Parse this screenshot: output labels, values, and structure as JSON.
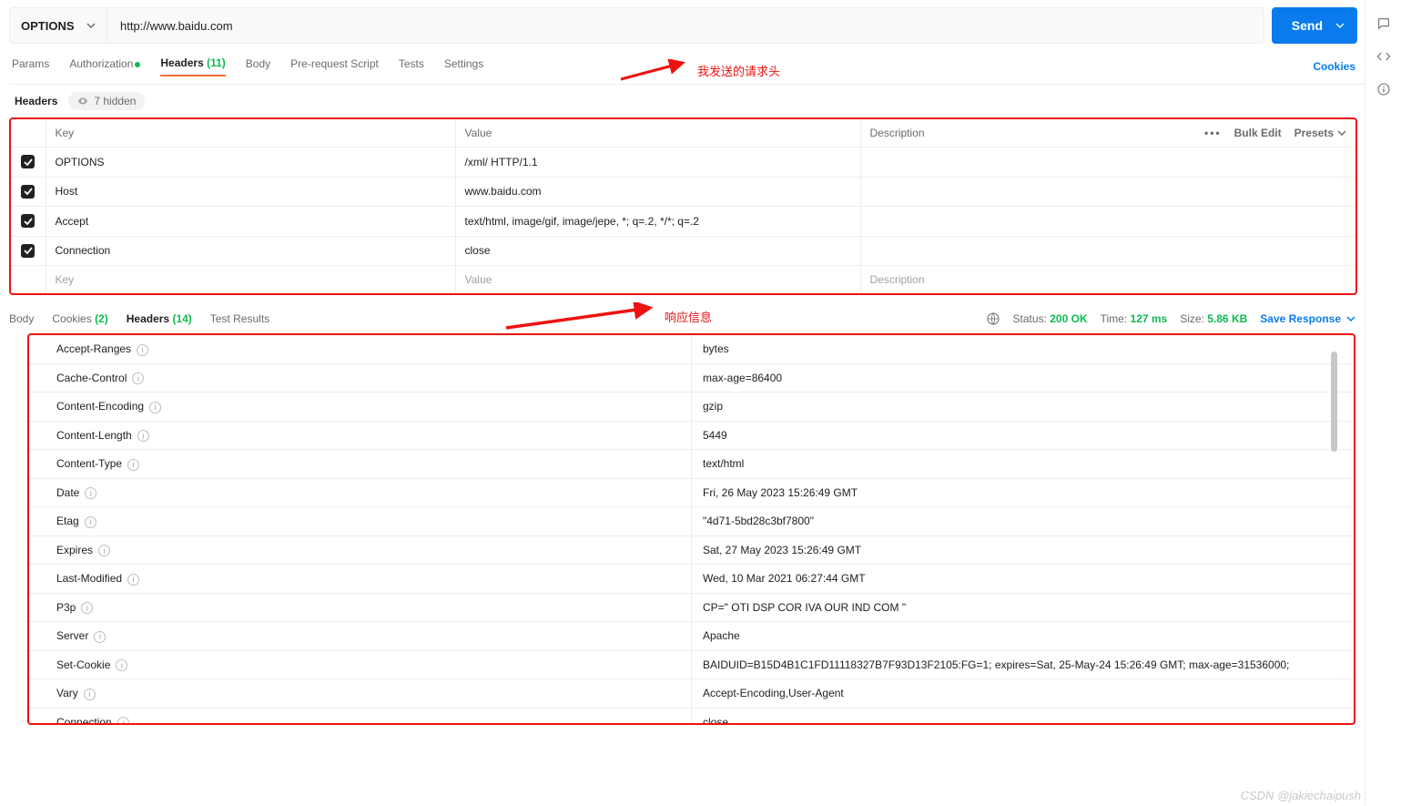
{
  "request": {
    "method": "OPTIONS",
    "url": "http://www.baidu.com",
    "send_label": "Send"
  },
  "req_tabs": {
    "params": "Params",
    "auth": "Authorization",
    "headers_label": "Headers",
    "headers_count": "(11)",
    "body": "Body",
    "prereq": "Pre-request Script",
    "tests": "Tests",
    "settings": "Settings",
    "cookies": "Cookies"
  },
  "sub_bar": {
    "headers_label": "Headers",
    "hidden_label": "7 hidden"
  },
  "req_table_head": {
    "key": "Key",
    "value": "Value",
    "description": "Description",
    "bulk_edit": "Bulk Edit",
    "presets": "Presets"
  },
  "req_headers": [
    {
      "key": "OPTIONS",
      "value": "/xml/ HTTP/1.1"
    },
    {
      "key": "Host",
      "value": "www.baidu.com"
    },
    {
      "key": "Accept",
      "value": "text/html, image/gif, image/jepe, *; q=.2, */*; q=.2"
    },
    {
      "key": "Connection",
      "value": "close"
    }
  ],
  "req_placeholders": {
    "key": "Key",
    "value": "Value",
    "description": "Description"
  },
  "annotations": {
    "request": "我发送的请求头",
    "response": "响应信息"
  },
  "resp_tabs": {
    "body": "Body",
    "cookies_label": "Cookies",
    "cookies_count": "(2)",
    "headers_label": "Headers",
    "headers_count": "(14)",
    "test_results": "Test Results"
  },
  "resp_meta": {
    "status_label": "Status:",
    "status_value": "200 OK",
    "time_label": "Time:",
    "time_value": "127 ms",
    "size_label": "Size:",
    "size_value": "5.86 KB",
    "save_label": "Save Response"
  },
  "resp_headers": [
    {
      "k": "Accept-Ranges",
      "v": "bytes"
    },
    {
      "k": "Cache-Control",
      "v": "max-age=86400"
    },
    {
      "k": "Content-Encoding",
      "v": "gzip"
    },
    {
      "k": "Content-Length",
      "v": "5449"
    },
    {
      "k": "Content-Type",
      "v": "text/html"
    },
    {
      "k": "Date",
      "v": "Fri, 26 May 2023 15:26:49 GMT"
    },
    {
      "k": "Etag",
      "v": "\"4d71-5bd28c3bf7800\""
    },
    {
      "k": "Expires",
      "v": "Sat, 27 May 2023 15:26:49 GMT"
    },
    {
      "k": "Last-Modified",
      "v": "Wed, 10 Mar 2021 06:27:44 GMT"
    },
    {
      "k": "P3p",
      "v": "CP=\" OTI DSP COR IVA OUR IND COM \""
    },
    {
      "k": "Server",
      "v": "Apache"
    },
    {
      "k": "Set-Cookie",
      "v": "BAIDUID=B15D4B1C1FD11118327B7F93D13F2105:FG=1; expires=Sat, 25-May-24 15:26:49 GMT; max-age=31536000;"
    },
    {
      "k": "Vary",
      "v": "Accept-Encoding,User-Agent"
    },
    {
      "k": "Connection",
      "v": "close"
    }
  ],
  "watermark": "CSDN @jakiechaipush"
}
